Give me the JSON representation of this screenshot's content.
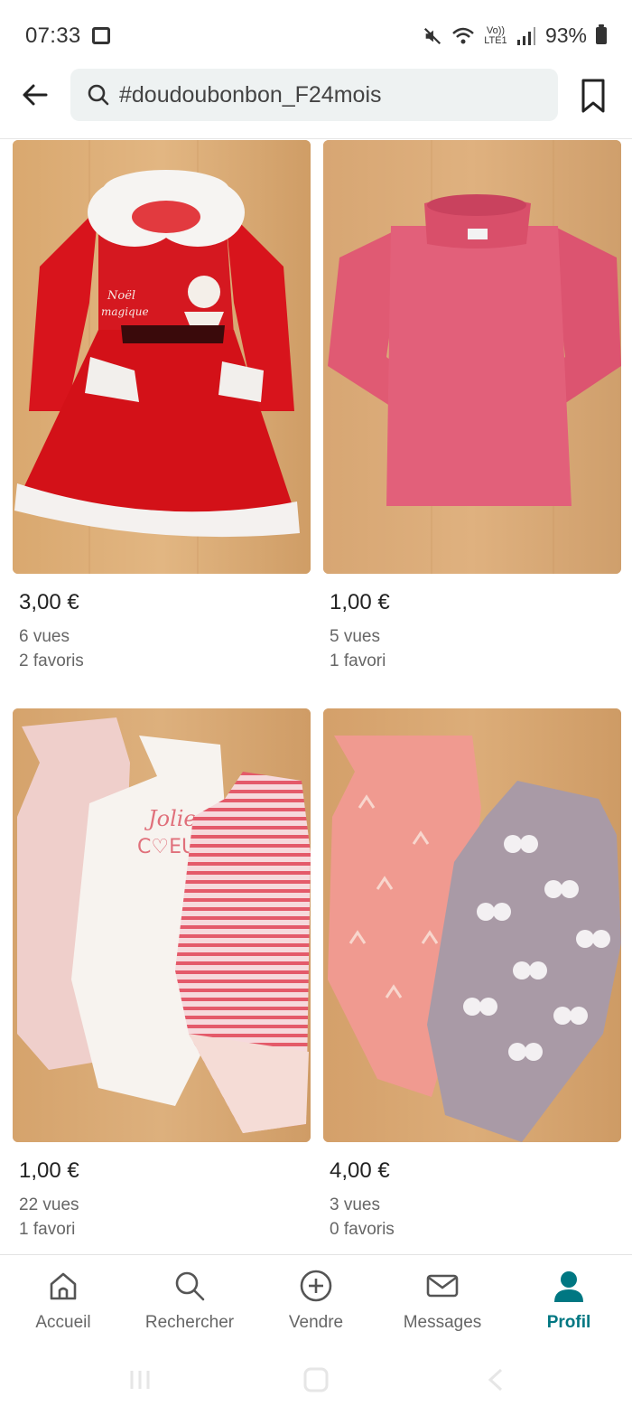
{
  "status_bar": {
    "time": "07:33",
    "network": "Vo)) LTE1",
    "battery": "93%"
  },
  "search": {
    "query": "#doudoubonbon_F24mois"
  },
  "items": [
    {
      "price": "3,00 €",
      "views": "6 vues",
      "favorites": "2 favoris",
      "image": "red-christmas-dress"
    },
    {
      "price": "1,00 €",
      "views": "5 vues",
      "favorites": "1 favori",
      "image": "pink-turtleneck-top"
    },
    {
      "price": "1,00 €",
      "views": "22 vues",
      "favorites": "1 favori",
      "image": "three-baby-bodysuits"
    },
    {
      "price": "4,00 €",
      "views": "3 vues",
      "favorites": "0 favoris",
      "image": "pink-and-lilac-bodysuits"
    }
  ],
  "nav": {
    "home": "Accueil",
    "search": "Rechercher",
    "sell": "Vendre",
    "messages": "Messages",
    "profile": "Profil"
  },
  "colors": {
    "accent": "#007782",
    "search_bg": "#eef2f2"
  }
}
